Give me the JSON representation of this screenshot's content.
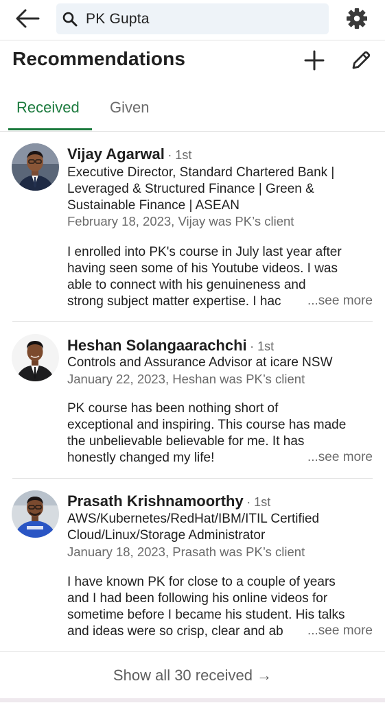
{
  "header": {
    "search_value": "PK Gupta",
    "icons": [
      "back-arrow-icon",
      "search-icon",
      "gear-icon"
    ]
  },
  "page": {
    "title": "Recommendations",
    "icons": [
      "plus-icon",
      "pencil-icon"
    ]
  },
  "tabs": [
    {
      "label": "Received",
      "active": true
    },
    {
      "label": "Given",
      "active": false
    }
  ],
  "recommendations": [
    {
      "name": "Vijay Agarwal",
      "degree": "· 1st",
      "headline": [
        "Executive Director, Standard Chartered Bank |",
        "Leveraged & Structured Finance | Green &",
        "Sustainable Finance | ASEAN"
      ],
      "meta": "February 18, 2023, Vijay was PK’s client",
      "text": [
        "I enrolled into PK's course in July last year after",
        "having seen some of his Youtube videos. I was",
        "able to connect with his genuineness and",
        "strong subject matter expertise. I hac"
      ],
      "see_more": "...see more"
    },
    {
      "name": "Heshan Solangaarachchi",
      "degree": "· 1st",
      "headline": [
        "Controls and Assurance Advisor at icare NSW"
      ],
      "meta": "January 22, 2023, Heshan was PK’s client",
      "text": [
        "PK course has been nothing short of",
        "exceptional and inspiring. This course has made",
        "the unbelievable believable for me. It has",
        "honestly changed my life!"
      ],
      "see_more": "...see more"
    },
    {
      "name": "Prasath Krishnamoorthy",
      "degree": "· 1st",
      "headline": [
        "AWS/Kubernetes/RedHat/IBM/ITIL Certified",
        "Cloud/Linux/Storage Administrator"
      ],
      "meta": "January 18, 2023, Prasath was PK’s client",
      "text": [
        "I have known PK for close to a couple of years",
        "and I had been following his online videos for",
        "sometime before I became his student. His talks",
        "and ideas were so crisp, clear and ab"
      ],
      "see_more": "...see more"
    }
  ],
  "footer": {
    "show_all": "Show all 30 received",
    "arrow": "→"
  },
  "colors": {
    "accent_green": "#1b7a3d",
    "secondary_text": "#6b6b6b",
    "search_bg": "#eef3f8"
  }
}
